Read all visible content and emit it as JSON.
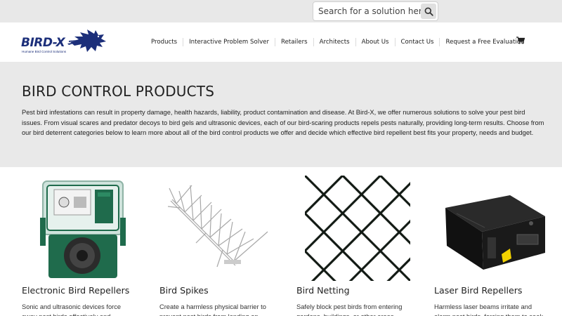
{
  "search": {
    "placeholder": "Search for a solution here...",
    "button_icon": "search-icon"
  },
  "logo": {
    "word": "BIRD-X",
    "tagline": "Humane Bird Control Solutions",
    "color": "#1c2f7a"
  },
  "nav": {
    "items": [
      {
        "label": "Products"
      },
      {
        "label": "Interactive Problem Solver"
      },
      {
        "label": "Retailers"
      },
      {
        "label": "Architects"
      },
      {
        "label": "About Us"
      },
      {
        "label": "Contact Us"
      },
      {
        "label": "Request a Free Evaluation"
      }
    ],
    "cart_icon": "shopping-cart-icon"
  },
  "intro": {
    "title": "BIRD CONTROL PRODUCTS",
    "text": "Pest bird infestations can result in property damage, health hazards, liability, product contamination and disease. At Bird-X, we offer numerous solutions to solve your pest bird issues. From visual scares and predator decoys to bird gels and ultrasonic devices, each of our bird-scaring products repels pests naturally, providing long-term results. Choose from our bird deterrent categories below to learn more about all of the bird control products we offer and decide which effective bird repellent best fits your property, needs and budget."
  },
  "products": [
    {
      "title": "Electronic Bird Repellers",
      "desc": "Sonic and ultrasonic devices force away pest birds effectively and"
    },
    {
      "title": "Bird Spikes",
      "desc": "Create a harmless physical barrier to prevent pest birds from landing on"
    },
    {
      "title": "Bird Netting",
      "desc": "Safely block pest birds from entering gardens, buildings, or other areas"
    },
    {
      "title": "Laser Bird Repellers",
      "desc": "Harmless laser beams irritate and alarm pest birds, forcing them to seek"
    }
  ],
  "colors": {
    "topbar": "#e8e8e8",
    "intro_bg": "#e9e9e9",
    "repeller_green": "#1f6b4c"
  }
}
